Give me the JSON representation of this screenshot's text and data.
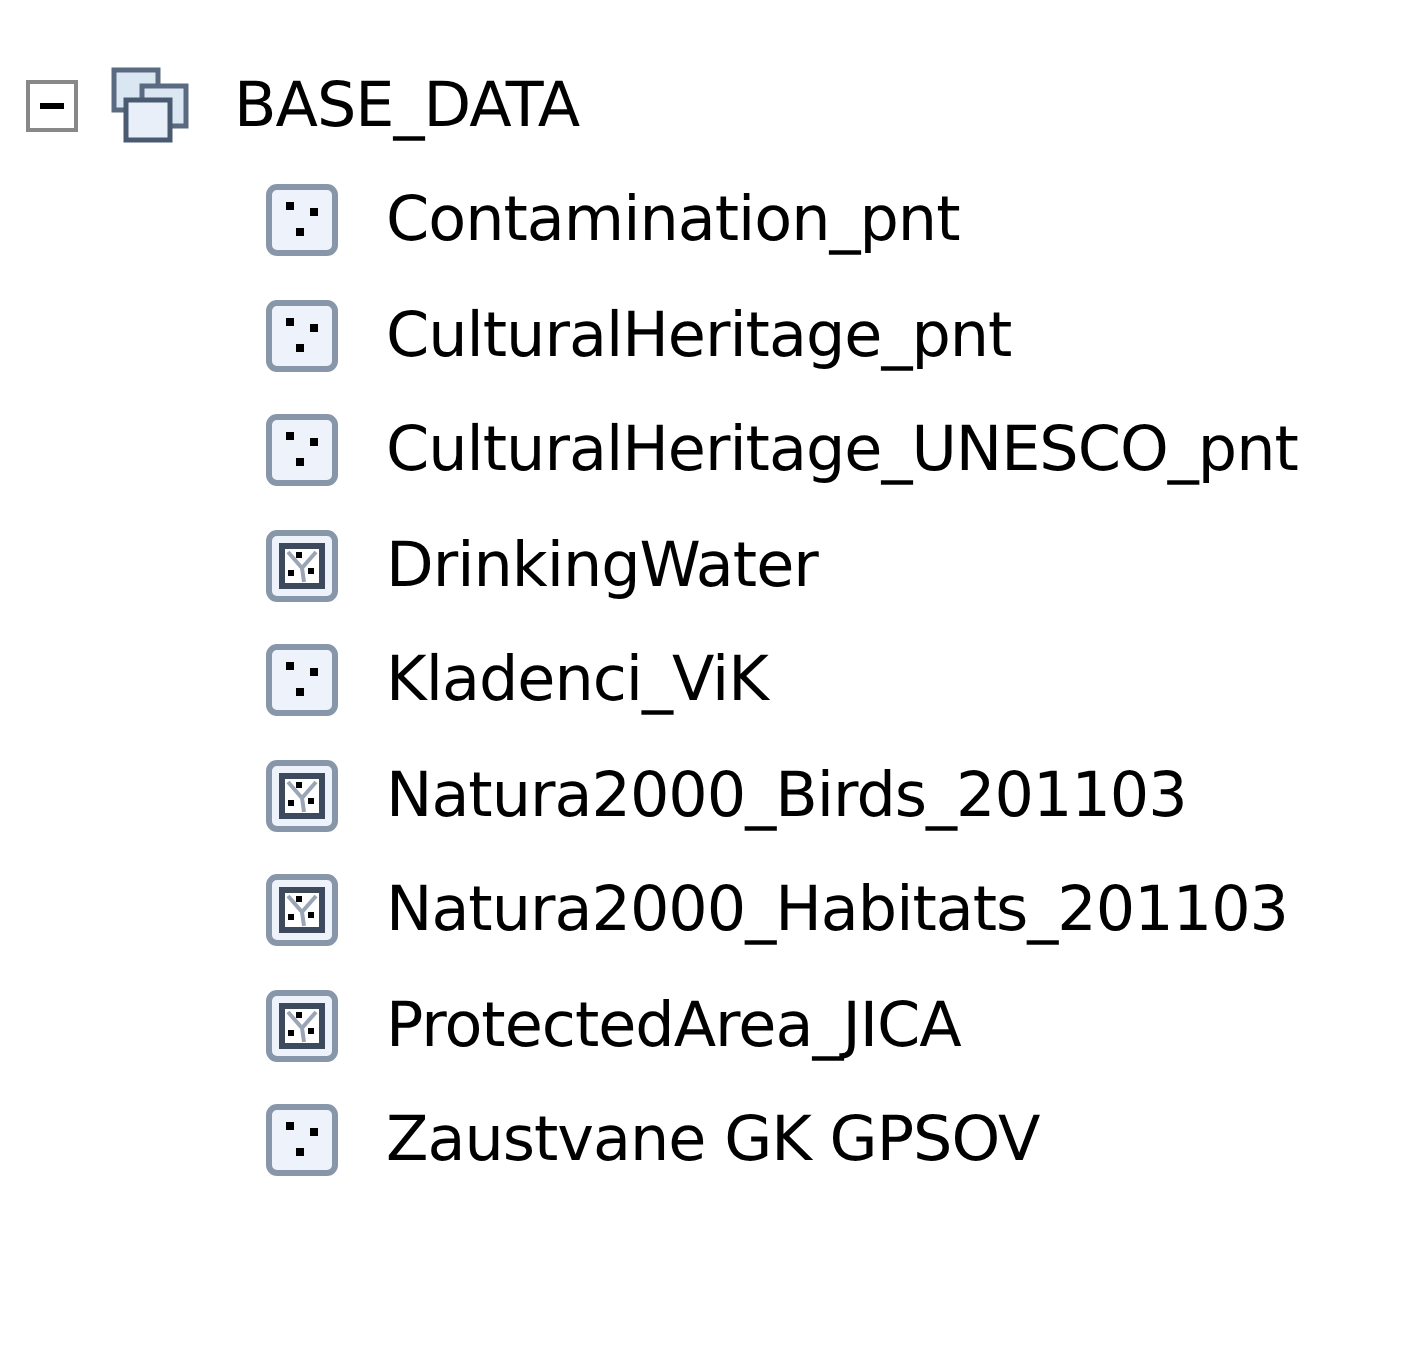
{
  "tree": {
    "label": "BASE_DATA",
    "expanded": true,
    "children": [
      {
        "label": "Contamination_pnt",
        "kind": "point"
      },
      {
        "label": "CulturalHeritage_pnt",
        "kind": "point"
      },
      {
        "label": "CulturalHeritage_UNESCO_pnt",
        "kind": "point"
      },
      {
        "label": "DrinkingWater",
        "kind": "polygon"
      },
      {
        "label": "Kladenci_ViK",
        "kind": "point"
      },
      {
        "label": "Natura2000_Birds_201103",
        "kind": "polygon"
      },
      {
        "label": "Natura2000_Habitats_201103",
        "kind": "polygon"
      },
      {
        "label": "ProtectedArea_JICA",
        "kind": "polygon"
      },
      {
        "label": "Zaustvane GK GPSOV",
        "kind": "point"
      }
    ]
  }
}
